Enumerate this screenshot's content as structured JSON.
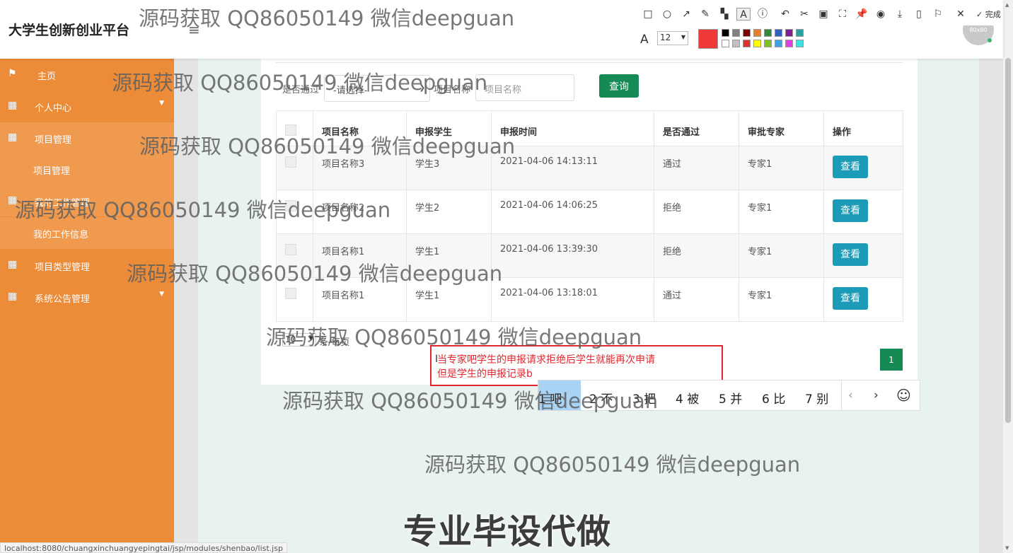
{
  "header": {
    "app_title": "大学生创新创业平台",
    "menu_icon": "≡",
    "avatar_text": "80x80"
  },
  "sidebar": {
    "items": [
      {
        "label": "主页",
        "icon": "flag-icon"
      },
      {
        "label": "个人中心",
        "icon": "grid-icon"
      },
      {
        "label": "项目管理",
        "icon": "grid-icon"
      },
      {
        "label": "项目管理",
        "icon": ""
      },
      {
        "label": "我的工作管理",
        "icon": "grid-icon"
      },
      {
        "label": "我的工作信息",
        "icon": ""
      },
      {
        "label": "项目类型管理",
        "icon": "grid-icon"
      },
      {
        "label": "系统公告管理",
        "icon": "grid-icon"
      }
    ]
  },
  "filters": {
    "approved_label": "是否通过",
    "approved_value": "-请选择-",
    "name_label": "项目名称",
    "name_placeholder": "项目名称",
    "search_button": "查询"
  },
  "table": {
    "columns": [
      "项目名称",
      "申报学生",
      "申报时间",
      "是否通过",
      "审批专家",
      "操作"
    ],
    "view_label": "查看",
    "rows": [
      {
        "name": "项目名称3",
        "student": "学生3",
        "time": "2021-04-06 14:13:11",
        "approved": "通过",
        "expert": "专家1"
      },
      {
        "name": "项目名称2",
        "student": "学生2",
        "time": "2021-04-06 14:06:25",
        "approved": "拒绝",
        "expert": "专家1"
      },
      {
        "name": "项目名称1",
        "student": "学生1",
        "time": "2021-04-06 13:39:30",
        "approved": "拒绝",
        "expert": "专家1"
      },
      {
        "name": "项目名称1",
        "student": "学生1",
        "time": "2021-04-06 13:18:01",
        "approved": "通过",
        "expert": "专家1"
      }
    ]
  },
  "pagination": {
    "page_size": "10",
    "page_size_label": "条/每页",
    "current_page": "1"
  },
  "annotation_toolbar": {
    "done_label": "完成",
    "font_size": "12",
    "current_color": "#f03a3a",
    "palette": [
      "#000000",
      "#808080",
      "#800000",
      "#e08030",
      "#2e8b3a",
      "#3060c0",
      "#802090",
      "#2aa0a0",
      "#ffffff",
      "#c0c0c0",
      "#e03030",
      "#ffff00",
      "#80c020",
      "#40a0e0",
      "#e040e0",
      "#40e0e0"
    ]
  },
  "annotation_text": {
    "line1": "当专家吧学生的申报请求拒绝后学生就能再次申请",
    "line2": "但是学生的申报记录b"
  },
  "ime": {
    "candidates": [
      "1 吧",
      "2 不",
      "3 把",
      "4 被",
      "5 并",
      "6 比",
      "7 别"
    ],
    "prev": "‹",
    "next": "›",
    "emoji": "☺"
  },
  "watermarks": {
    "text": "源码获取 QQ86050149 微信deepguan",
    "ad": "专业毕设代做"
  },
  "statusbar": {
    "url": "localhost:8080/chuangxinchuangyepingtai/jsp/modules/shenbao/list.jsp"
  },
  "colors": {
    "sidebar": "#ec8b38",
    "primary_button": "#168a55",
    "view_button": "#1b9bb5",
    "annotation": "#e0272f"
  }
}
